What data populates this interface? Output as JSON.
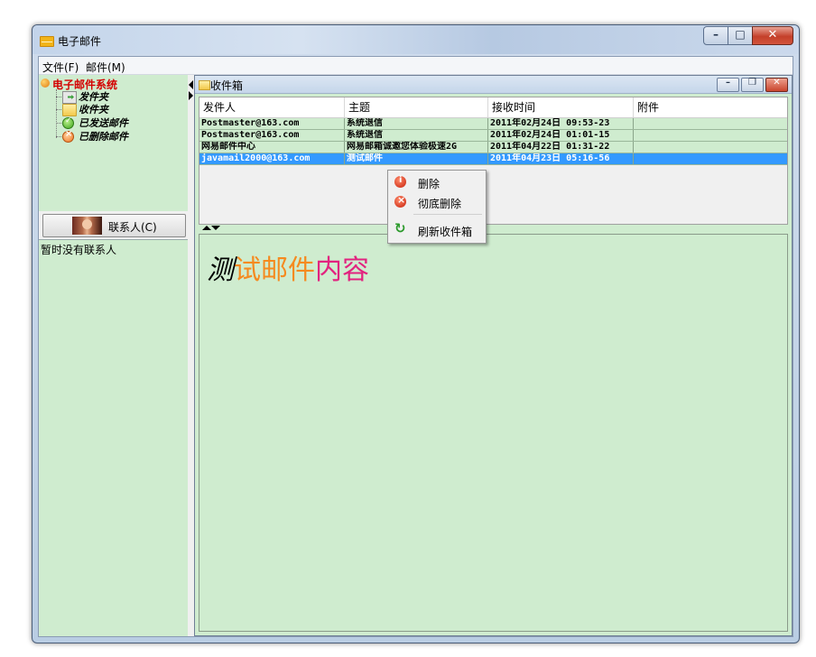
{
  "window": {
    "title": "电子邮件",
    "min_icon": "minimize-icon",
    "max_icon": "maximize-icon",
    "close_icon": "close-icon"
  },
  "menubar": {
    "items": [
      "文件(F)",
      "邮件(M)"
    ]
  },
  "tree": {
    "root": {
      "label": "电子邮件系统",
      "icon": "app-root-icon",
      "color": "#d40000"
    },
    "items": [
      {
        "label": "发件夹",
        "icon": "outbox-icon"
      },
      {
        "label": "收件夹",
        "icon": "folder-icon"
      },
      {
        "label": "已发送邮件",
        "icon": "sent-check-icon"
      },
      {
        "label": "已删除邮件",
        "icon": "deleted-icon"
      }
    ]
  },
  "contacts": {
    "button_label": "联系人(C)",
    "empty_text": "暂时没有联系人"
  },
  "inbox": {
    "title": "收件箱",
    "columns": [
      "发件人",
      "主题",
      "接收时间",
      "附件"
    ],
    "rows": [
      {
        "sender": "Postmaster@163.com",
        "subject": "系统退信",
        "time": "2011年02月24日 09:53-23",
        "attachment": "",
        "selected": false
      },
      {
        "sender": "Postmaster@163.com",
        "subject": "系统退信",
        "time": "2011年02月24日 01:01-15",
        "attachment": "",
        "selected": false
      },
      {
        "sender": "网易邮件中心",
        "subject": "网易邮箱诚邀您体验极速2G",
        "time": "2011年04月22日 01:31-22",
        "attachment": "",
        "selected": false
      },
      {
        "sender": "javamail2000@163.com",
        "subject": "测试邮件",
        "time": "2011年04月23日 05:16-56",
        "attachment": "",
        "selected": true
      }
    ],
    "preview": {
      "part1": "测",
      "part2": "试邮件",
      "part3": "内容"
    }
  },
  "context_menu": {
    "items": [
      {
        "label": "删除",
        "icon": "info-icon"
      },
      {
        "label": "彻底删除",
        "icon": "delete-icon"
      },
      {
        "label": "刷新收件箱",
        "icon": "refresh-icon"
      }
    ]
  },
  "colors": {
    "panel_bg": "#cfeccf",
    "selection": "#3399ff",
    "preview_orange": "#f58a1f",
    "preview_magenta": "#e2237f"
  }
}
